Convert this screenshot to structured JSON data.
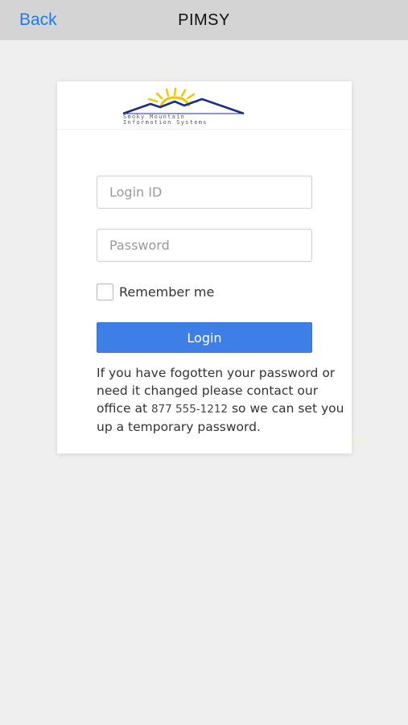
{
  "nav": {
    "back_label": "Back",
    "title": "PIMSY"
  },
  "logo": {
    "line1": "Smoky Mountain",
    "line2": "Information Systems",
    "sun_color": "#f2c500",
    "mountain_color": "#1c2c8c"
  },
  "form": {
    "login_placeholder": "Login ID",
    "login_value": "",
    "password_placeholder": "Password",
    "password_value": "",
    "remember_label": "Remember me",
    "remember_checked": false,
    "login_button": "Login"
  },
  "help": {
    "text_before": "If you have fogotten your password or need it changed please contact our office at ",
    "phone": "877 555-1212",
    "text_after": " so we can set you up a temporary password."
  },
  "colors": {
    "accent": "#3d7fe6",
    "nav_link": "#1b7cf1",
    "navbar_bg": "#d4d4d4",
    "page_bg": "#efefef"
  }
}
